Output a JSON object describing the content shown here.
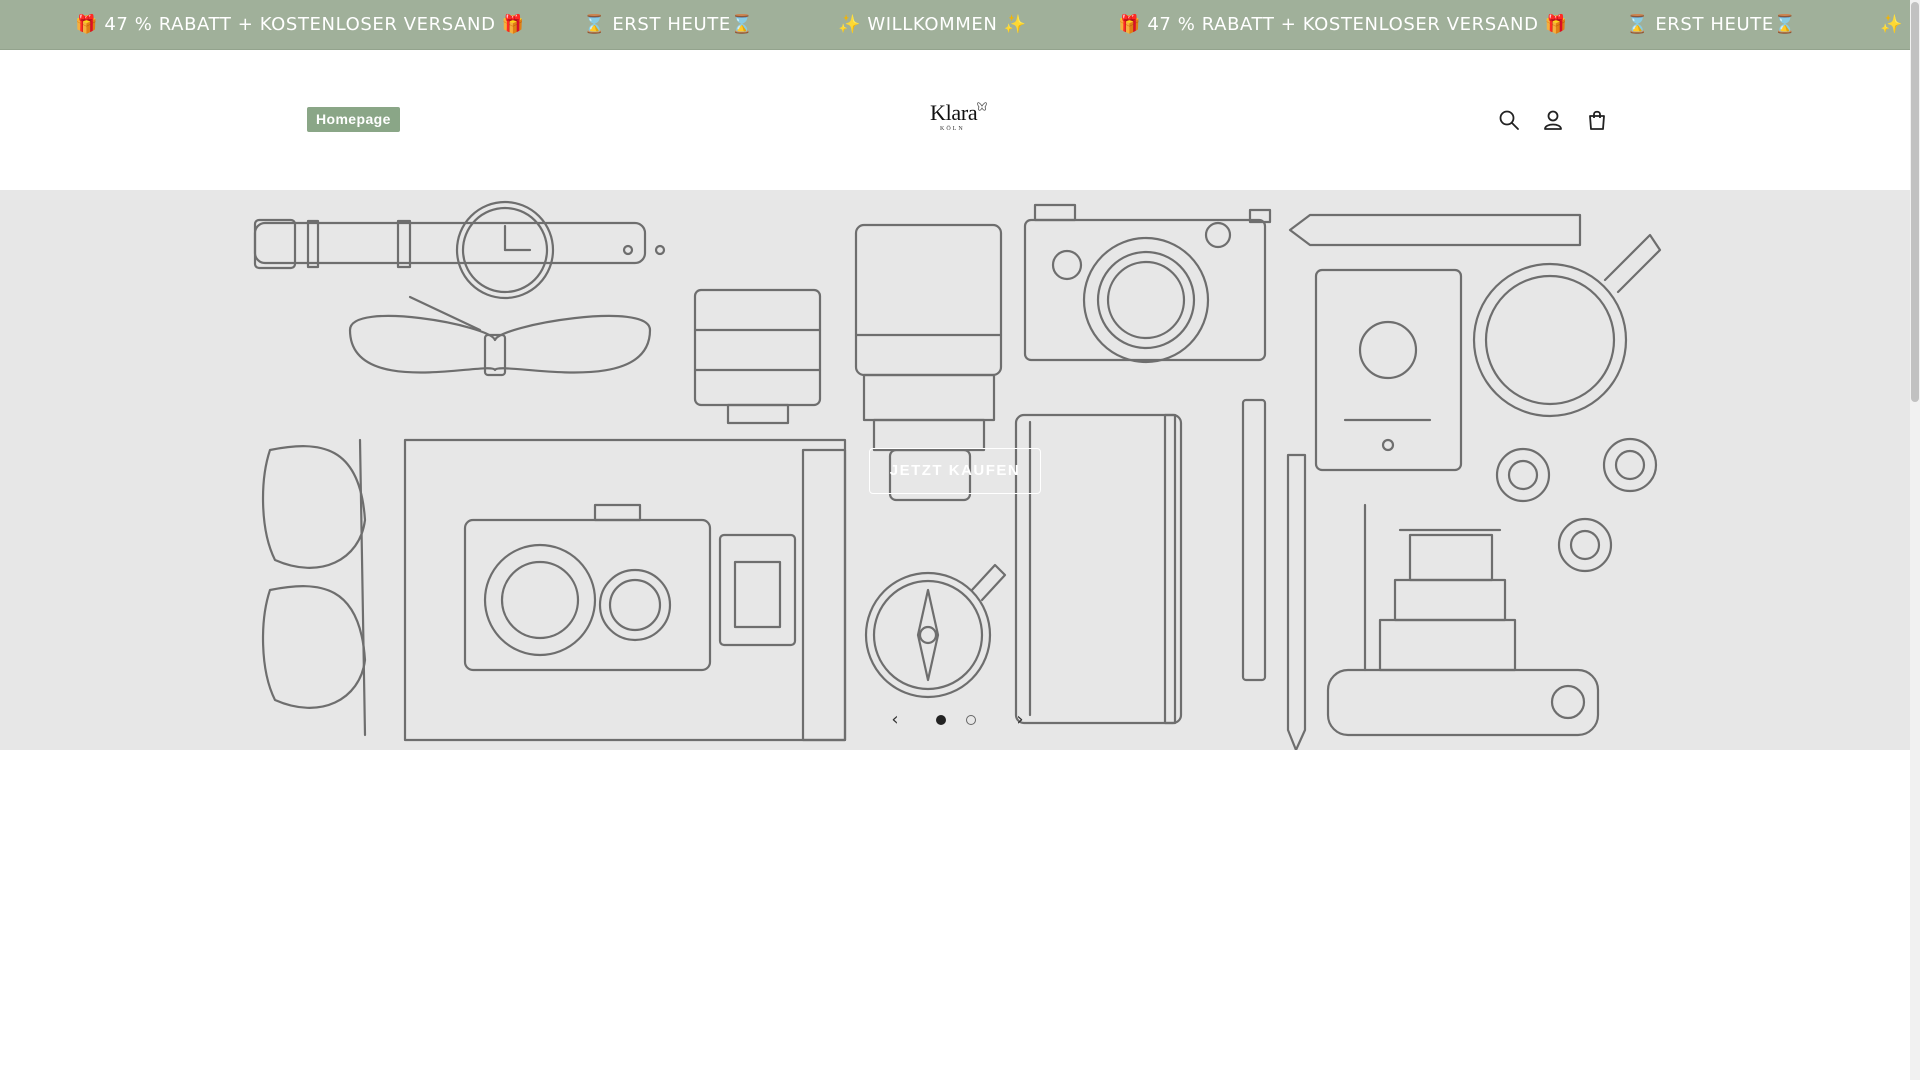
{
  "announcement": {
    "items": [
      "🎁 47 % RABATT + KOSTENLOSER VERSAND 🎁",
      "⌛ ERST HEUTE⌛",
      "✨ WILLKOMMEN ✨",
      "🎁 47 % RABATT + KOSTENLOSER VERSAND 🎁",
      "⌛ ERST HEUTE⌛",
      "✨ W"
    ]
  },
  "header": {
    "nav": {
      "homepage_label": "Homepage"
    },
    "logo": {
      "word": "Klara",
      "sub": "KÖLN"
    },
    "icons": [
      "search-icon",
      "account-icon",
      "cart-icon"
    ]
  },
  "hero": {
    "cta_label": "JETZT KAUFEN",
    "slider": {
      "prev": "‹",
      "next": "›",
      "slides": 2,
      "active": 1
    }
  },
  "colors": {
    "announcement_bg": "#a0b09a",
    "nav_pill_bg": "#8aa687",
    "hero_bg": "#e7e7e7",
    "line_art": "#6e6e6e"
  }
}
